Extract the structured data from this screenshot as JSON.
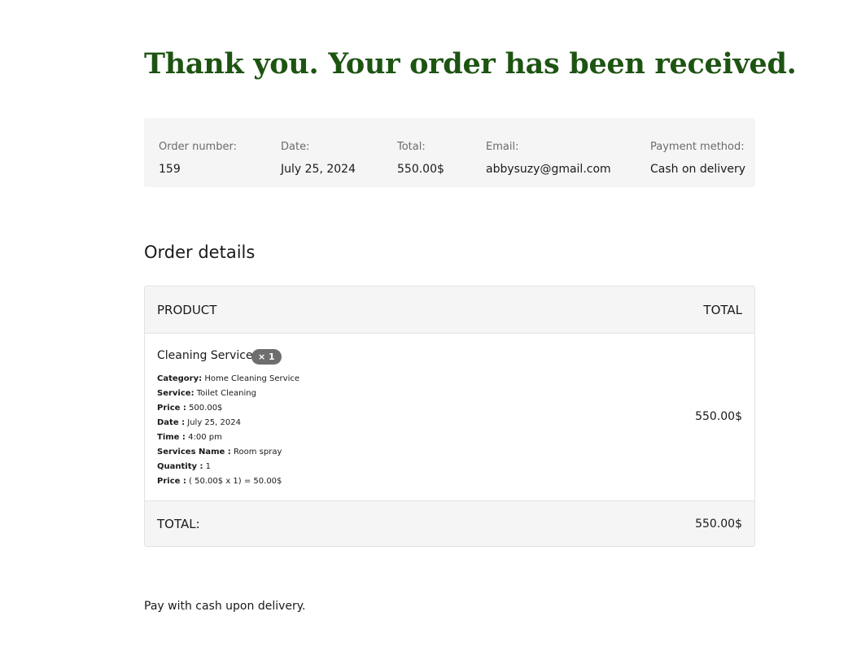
{
  "page_title": "Thank you. Your order has been received.",
  "colors": {
    "heading": "#1d5412",
    "panel_bg": "#f5f5f5",
    "badge_bg": "#6e6e6e"
  },
  "overview": {
    "order_number": {
      "label": "Order number:",
      "value": "159"
    },
    "date": {
      "label": "Date:",
      "value": "July 25, 2024"
    },
    "total": {
      "label": "Total:",
      "value": "550.00$"
    },
    "email": {
      "label": "Email:",
      "value": "abbysuzy@gmail.com"
    },
    "payment_method": {
      "label": "Payment method:",
      "value": "Cash on delivery"
    }
  },
  "order_details": {
    "heading": "Order details",
    "columns": {
      "product": "PRODUCT",
      "total": "TOTAL"
    },
    "item": {
      "name": "Cleaning Service",
      "quantity_badge": "× 1",
      "meta": [
        {
          "key": "Category:",
          "value": " Home Cleaning Service"
        },
        {
          "key": "Service:",
          "value": " Toilet Cleaning"
        },
        {
          "key": "Price :",
          "value": " 500.00$"
        },
        {
          "key": "Date :",
          "value": " July 25, 2024"
        },
        {
          "key": "Time :",
          "value": " 4:00 pm"
        },
        {
          "key": "Services Name :",
          "value": " Room spray"
        },
        {
          "key": "Quantity :",
          "value": " 1"
        },
        {
          "key": "Price :",
          "value": " ( 50.00$ x 1) = 50.00$"
        }
      ],
      "total": "550.00$"
    },
    "footer": {
      "label": "TOTAL:",
      "value": "550.00$"
    }
  },
  "payment_note": "Pay with cash upon delivery."
}
